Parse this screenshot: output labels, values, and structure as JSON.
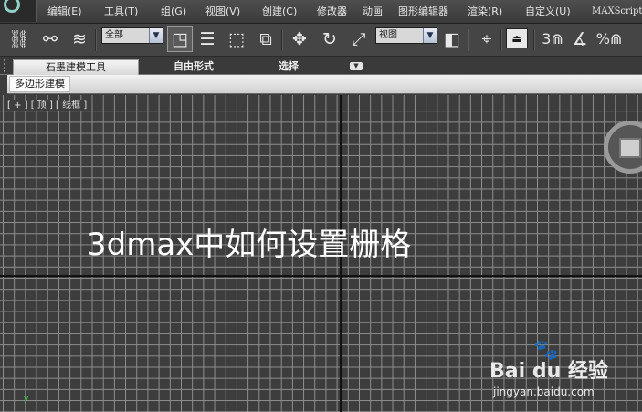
{
  "menubar": {
    "items": [
      "编辑(E)",
      "工具(T)",
      "组(G)",
      "视图(V)",
      "创建(C)",
      "修改器",
      "动画",
      "图形编辑器",
      "渲染(R)",
      "自定义(U)",
      "MAXScript"
    ]
  },
  "toolbar": {
    "selection_filter": "全部",
    "reference_coord": "视图",
    "icons": [
      "link-icon",
      "unlink-icon",
      "bind-spacewarp-icon",
      "select-object-icon",
      "select-by-name-icon",
      "rect-selection-icon",
      "window-crossing-icon",
      "move-icon",
      "rotate-icon",
      "scale-icon",
      "use-pivot-icon",
      "select-manipulate-icon",
      "snap-3d-icon",
      "angle-snap-icon",
      "percent-snap-icon"
    ],
    "snap_label": "3",
    "percent_label": "%"
  },
  "ribbon": {
    "tabs": [
      "石墨建模工具",
      "自由形式",
      "选择"
    ],
    "active_tab": "石墨建模工具",
    "panel_label": "多边形建模"
  },
  "viewport": {
    "label": "[ + ] [ 顶 ] [ 线框 ]",
    "title_overlay": "3dmax中如何设置栅格",
    "axis_indicator": "y",
    "grid_color": "#8e8e8e",
    "background_color": "#3d3d3d"
  },
  "watermark": {
    "brand": "Bai du 经验",
    "url": "jingyan.baidu.com"
  }
}
